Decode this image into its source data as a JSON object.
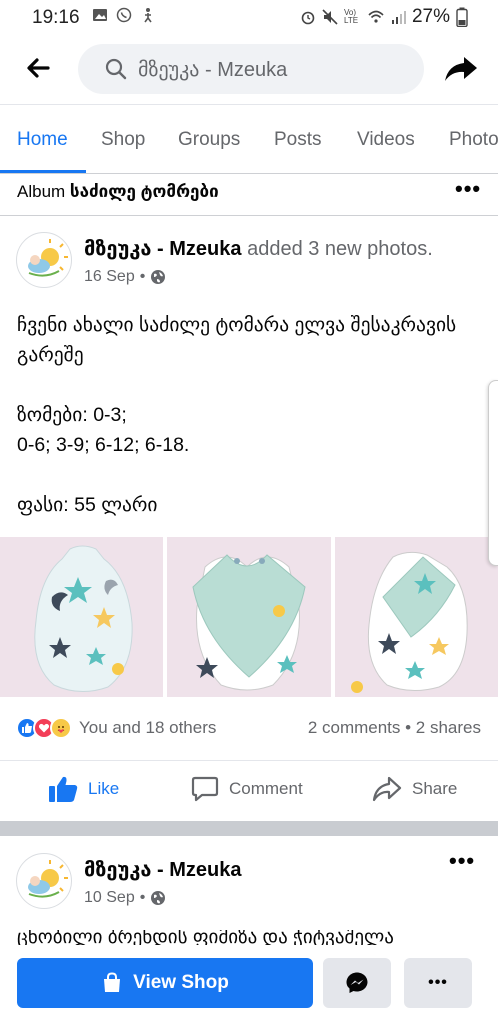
{
  "status_bar": {
    "time": "19:16",
    "lte_label": "Vo) LTE",
    "battery": "27%"
  },
  "header": {
    "search_text": "მზეუკა - Mzeuka"
  },
  "tabs": [
    "Home",
    "Shop",
    "Groups",
    "Posts",
    "Videos",
    "Photos"
  ],
  "album": {
    "prefix": "Album",
    "name": "საძილე ტომრები"
  },
  "post1": {
    "author": "მზეუკა - Mzeuka",
    "action": "added 3 new photos.",
    "date": "16 Sep",
    "separator": "•",
    "text_lines": [
      "ჩვენი ახალი საძილე ტომარა ელვა შესაკრავის გარეშე",
      "ზომები: 0-3;\n0-6; 3-9; 6-12; 6-18.",
      "ფასი: 55 ლარი"
    ],
    "reactions_text": "You and 18 others",
    "comments_shares": "2 comments • 2 shares",
    "actions": {
      "like": "Like",
      "comment": "Comment",
      "share": "Share"
    }
  },
  "post2": {
    "author": "მზეუკა - Mzeuka",
    "date": "10 Sep",
    "separator": "•",
    "cutoff_text": "ცნობილი ბრენდის ფიმიზა და ჭიტვაშელა"
  },
  "bottom": {
    "view_shop": "View Shop"
  },
  "colors": {
    "accent": "#1877f2",
    "muted": "#65676b",
    "photo_bg": "#efe2ea",
    "bag_mint": "#b9ddd4"
  }
}
